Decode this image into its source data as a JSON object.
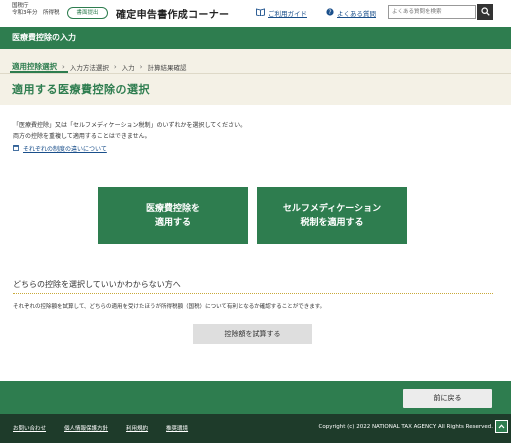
{
  "header": {
    "agency_line1": "国税庁",
    "agency_line2": "令和3年分　所得税",
    "badge": "書面提出",
    "title": "確定申告書作成コーナー",
    "guide_link": "ご利用ガイド",
    "faq_link": "よくある質問",
    "search_placeholder": "よくある質問を検索"
  },
  "section_band": "医療費控除の入力",
  "steps": [
    "適用控除選択",
    "入力方法選択",
    "入力",
    "計算結果確認"
  ],
  "page_title": "適用する医療費控除の選択",
  "description": {
    "line1": "「医療費控除」又は「セルフメディケーション税制」のいずれかを選択してください。",
    "line2": "両方の控除を重複して適用することはできません。",
    "link": "それぞれの制度の違いについて"
  },
  "choices": {
    "medical_line1": "医療費控除を",
    "medical_line2": "適用する",
    "self_line1": "セルフメディケーション",
    "self_line2": "税制を適用する"
  },
  "help": {
    "title": "どちらの控除を選択していいかわからない方へ",
    "desc": "それぞれの控除額を試算して、どちらの適用を受けたほうが所得税額（国税）について有利となるか確認することができます。",
    "trial_button": "控除額を試算する"
  },
  "back_button": "前に戻る",
  "footer": {
    "links": [
      "お問い合わせ",
      "個人情報保護方針",
      "利用規約",
      "推奨環境"
    ],
    "copyright": "Copyright (c) 2022 NATIONAL TAX AGENCY All Rights Reserved."
  },
  "colors": {
    "brand_green": "#2e7d4f",
    "footer_dark": "#1e3b2a",
    "progress_bg": "#f4f1e6",
    "link_blue": "#1a4f8b"
  }
}
